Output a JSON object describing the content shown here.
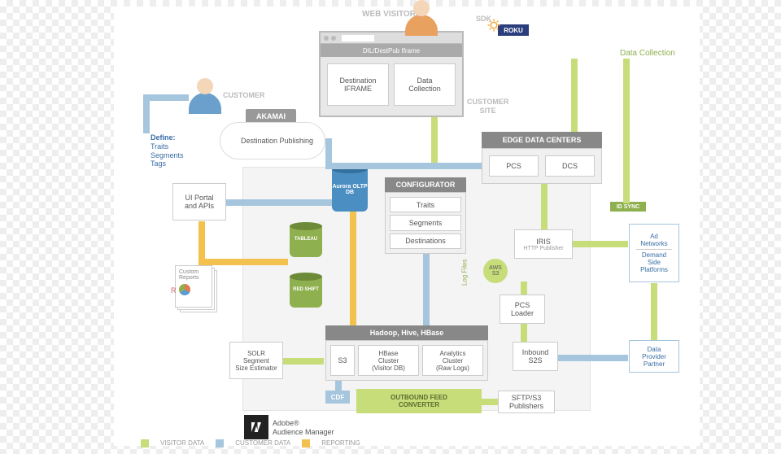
{
  "title_top": {
    "web_visitors": "WEB VISITORS",
    "sdk": "SDK",
    "roku": "ROKU"
  },
  "customer_label": "CUSTOMER",
  "define": {
    "title": "Define:",
    "items": [
      "Traits",
      "Segments",
      "Tags"
    ]
  },
  "akamai": {
    "title": "AKAMAI",
    "sub": "Destination Publishing"
  },
  "browser": {
    "bar": "DIL/DestPub Iframe",
    "dest_iframe": "Destination\nIFRAME",
    "data_collection": "Data\nCollection"
  },
  "customer_site": "CUSTOMER\nSITE",
  "data_collection_top": "Data Collection",
  "ui_portal": "UI Portal\nand APIs",
  "configurator": {
    "title": "CONFIGURATOR",
    "items": [
      "Traits",
      "Segments",
      "Destinations"
    ]
  },
  "edge": {
    "title": "EDGE DATA CENTERS",
    "pcs": "PCS",
    "dcs": "DCS"
  },
  "id_sync": "ID SYNC",
  "iris": {
    "title": "IRIS",
    "sub": "HTTP Publisher"
  },
  "aws_s3": "AWS\nS3",
  "log_files": "Log Files",
  "pcs_loader": "PCS\nLoader",
  "hadoop": {
    "title": "Hadoop, Hive, HBase",
    "s3": "S3",
    "hbase": "HBase\nCluster\n(Visitor DB)",
    "analytics": "Analytics\nCluster\n(Raw Logs)"
  },
  "inbound": "Inbound\nS2S",
  "solr": "SOLR\nSegment\nSize Estimator",
  "cdf": "CDF",
  "outbound": "OUTBOUND FEED\nCONVERTER",
  "sftp": "SFTP/S3\nPublishers",
  "adobe": {
    "name": "Adobe®",
    "product": "Audience Manager"
  },
  "legend": {
    "visitor": "VISITOR DATA",
    "customer": "CUSTOMER DATA",
    "reporting": "REPORTING"
  },
  "right": {
    "ad_networks": "Ad\nNetworks",
    "dsp": "Demand\nSide\nPlatforms",
    "dpp": "Data\nProvider\nPartner"
  },
  "custom_reports": "Custom\nReports",
  "dbs": {
    "aurora": "Aurora\nOLTP DB",
    "tableau": "TABLEAU",
    "redshift": "RED SHIFT"
  }
}
